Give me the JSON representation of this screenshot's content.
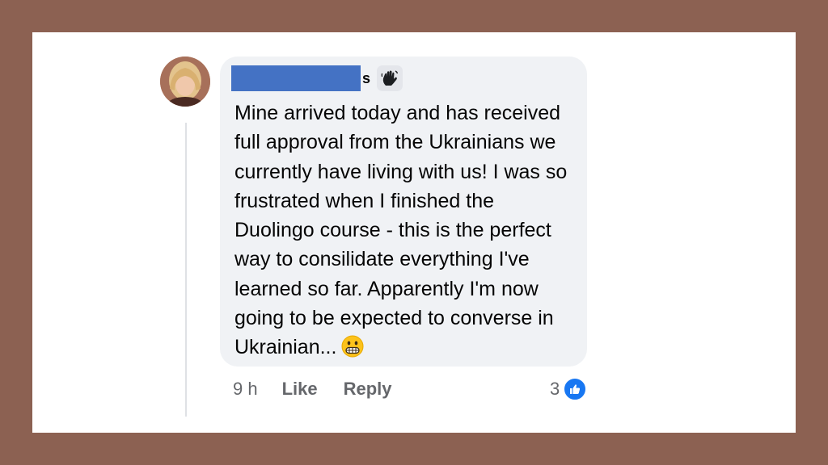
{
  "comment": {
    "author_suffix": "s",
    "badge_icon": "waving-hand-icon",
    "text_lines": [
      "Mine arrived today and has received",
      "full approval from the Ukrainians we",
      "currently have living with us! I was so",
      "frustrated when I finished the",
      "Duolingo course - this is the perfect",
      "way to consilidate everything I've",
      "learned so far. Apparently I'm now",
      "going to be expected to converse in",
      "Ukrainian..."
    ],
    "emoji": "grimacing-face-icon"
  },
  "actions": {
    "time": "9 h",
    "like_label": "Like",
    "reply_label": "Reply"
  },
  "reactions": {
    "count": "3",
    "icon": "thumbs-up-icon"
  },
  "colors": {
    "frame": "#8c6152",
    "bubble": "#f0f2f5",
    "redaction": "#4472c4",
    "like_blue": "#1877f2",
    "meta_text": "#65676b"
  }
}
